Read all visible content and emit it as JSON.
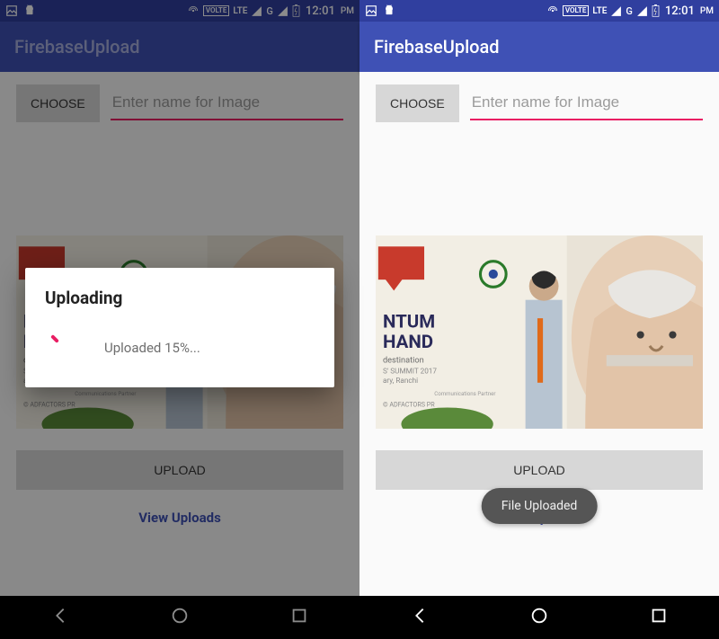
{
  "status": {
    "volte": "VOLTE",
    "lte": "LTE",
    "g": "G",
    "time": "12:01",
    "ampm": "PM"
  },
  "app": {
    "title": "FirebaseUpload"
  },
  "controls": {
    "choose_label": "CHOOSE",
    "name_placeholder": "Enter name for Image",
    "upload_label": "UPLOAD",
    "view_uploads_label": "View Uploads"
  },
  "dialog": {
    "title": "Uploading",
    "message": "Uploaded 15%...",
    "percent": 15
  },
  "toast": {
    "message": "File Uploaded"
  },
  "colors": {
    "primary": "#3F51B5",
    "primary_dark": "#303F9F",
    "accent": "#E91E63"
  }
}
